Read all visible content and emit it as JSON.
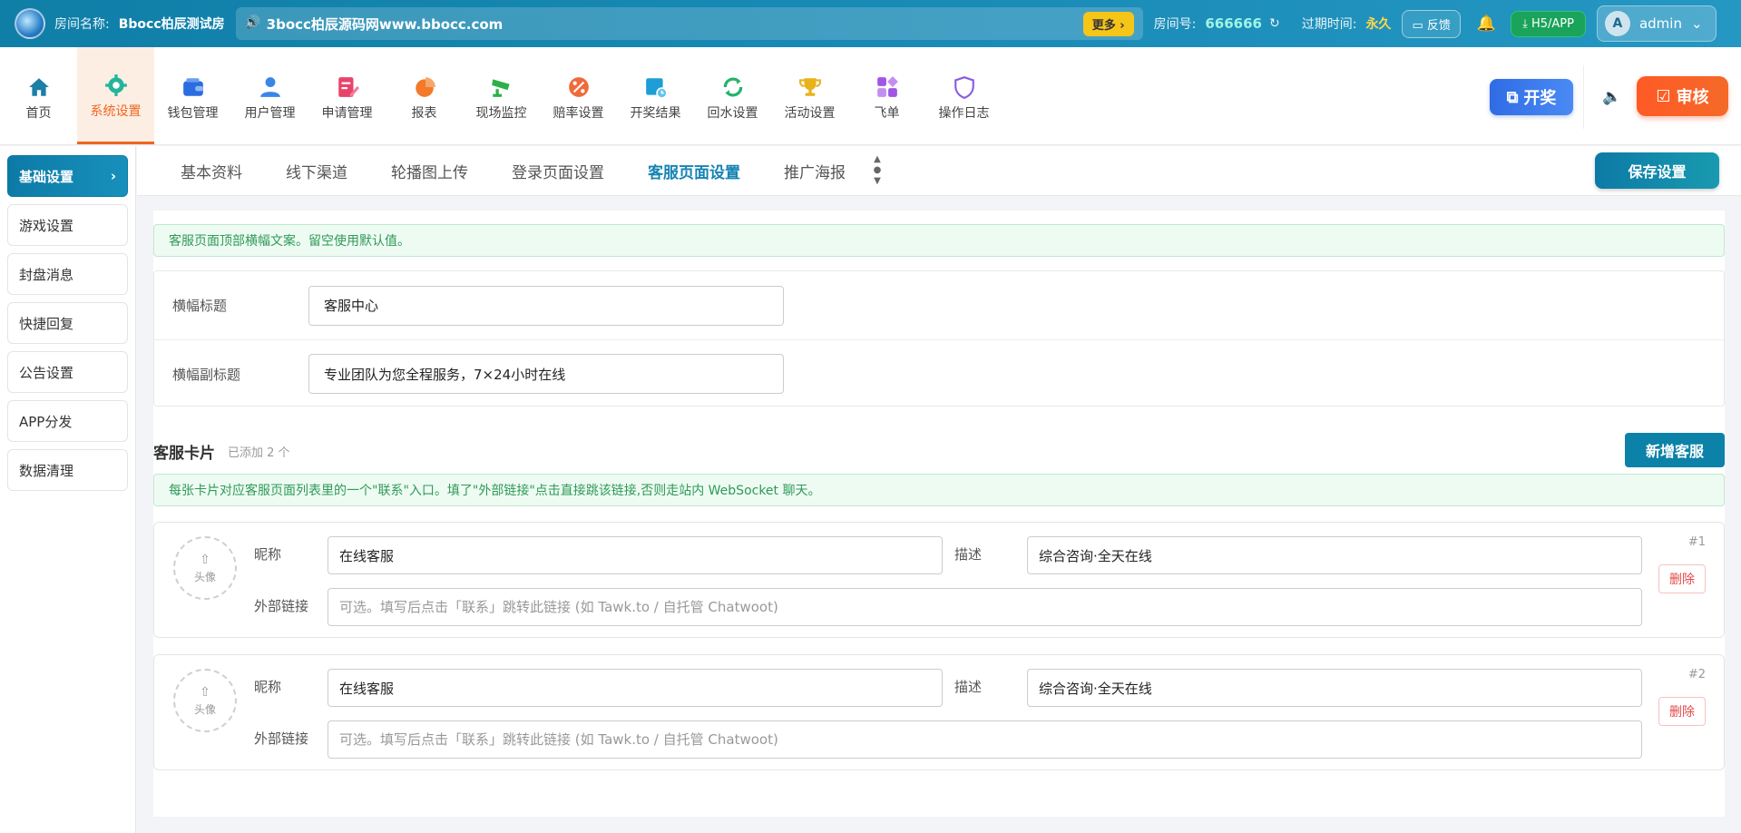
{
  "topbar": {
    "room_label": "房间名称:",
    "room_name": "Bbocc柏辰测试房",
    "marquee_text": "3bocc柏辰源码网www.bbocc.com",
    "more": "更多 ›",
    "room_id_label": "房间号:",
    "room_id": "666666",
    "expire_label": "过期时间:",
    "expire_value": "永久",
    "feedback": "反馈",
    "h5app": "H5/APP",
    "user_initial": "A",
    "user_name": "admin"
  },
  "nav": {
    "items": [
      {
        "label": "首页",
        "icon": "home-icon",
        "color": "#1b7fa6"
      },
      {
        "label": "系统设置",
        "icon": "gear-icon",
        "color": "#23b59a"
      },
      {
        "label": "钱包管理",
        "icon": "wallet-icon",
        "color": "#2a6de0"
      },
      {
        "label": "用户管理",
        "icon": "user-icon",
        "color": "#3a86e8"
      },
      {
        "label": "申请管理",
        "icon": "edit-doc-icon",
        "color": "#e8446a"
      },
      {
        "label": "报表",
        "icon": "pie-chart-icon",
        "color": "#f27a2a"
      },
      {
        "label": "现场监控",
        "icon": "camera-icon",
        "color": "#2db04a"
      },
      {
        "label": "赔率设置",
        "icon": "percent-icon",
        "color": "#f06a3a"
      },
      {
        "label": "开奖结果",
        "icon": "calendar-clock-icon",
        "color": "#1e9ed6"
      },
      {
        "label": "回水设置",
        "icon": "refresh-icon",
        "color": "#27b36a"
      },
      {
        "label": "活动设置",
        "icon": "trophy-icon",
        "color": "#e8b21a"
      },
      {
        "label": "飞单",
        "icon": "apps-icon",
        "color": "#a055e6"
      },
      {
        "label": "操作日志",
        "icon": "shield-icon",
        "color": "#8a5de0"
      }
    ],
    "kaijiang": "开奖",
    "shenhe": "审核"
  },
  "sidebar": {
    "items": [
      {
        "label": "基础设置"
      },
      {
        "label": "游戏设置"
      },
      {
        "label": "封盘消息"
      },
      {
        "label": "快捷回复"
      },
      {
        "label": "公告设置"
      },
      {
        "label": "APP分发"
      },
      {
        "label": "数据清理"
      }
    ]
  },
  "tabs": {
    "items": [
      "基本资料",
      "线下渠道",
      "轮播图上传",
      "登录页面设置",
      "客服页面设置",
      "推广海报"
    ],
    "save": "保存设置"
  },
  "banner_notice": "客服页面顶部横幅文案。留空使用默认值。",
  "form": {
    "title_label": "横幅标题",
    "title_value": "客服中心",
    "subtitle_label": "横幅副标题",
    "subtitle_value": "专业团队为您全程服务，7×24小时在线"
  },
  "cards_section": {
    "title": "客服卡片",
    "count": "已添加 2 个",
    "add": "新增客服",
    "notice": "每张卡片对应客服页面列表里的一个\"联系\"入口。填了\"外部链接\"点击直接跳该链接,否则走站内 WebSocket 聊天。"
  },
  "cards": [
    {
      "avatar": "头像",
      "nickname_label": "昵称",
      "nickname": "在线客服",
      "desc_label": "描述",
      "desc": "综合咨询·全天在线",
      "link_label": "外部链接",
      "link_placeholder": "可选。填写后点击「联系」跳转此链接 (如 Tawk.to / 自托管 Chatwoot)",
      "num": "#1",
      "delete": "删除"
    },
    {
      "avatar": "头像",
      "nickname_label": "昵称",
      "nickname": "在线客服",
      "desc_label": "描述",
      "desc": "综合咨询·全天在线",
      "link_label": "外部链接",
      "link_placeholder": "可选。填写后点击「联系」跳转此链接 (如 Tawk.to / 自托管 Chatwoot)",
      "num": "#2",
      "delete": "删除"
    }
  ]
}
